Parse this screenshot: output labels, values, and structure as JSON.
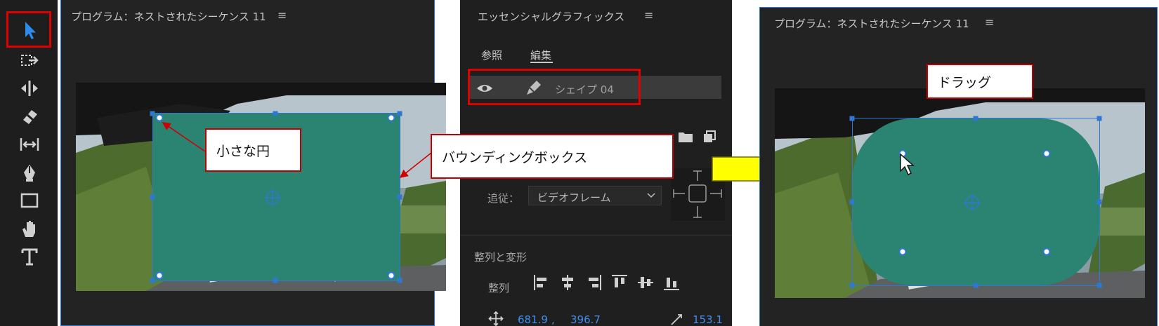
{
  "left_panel": {
    "title": "プログラム：ネストされたシーケンス 11",
    "menu_glyph": "≡"
  },
  "essential_graphics": {
    "title": "エッセンシャルグラフィックス",
    "menu_glyph": "≡",
    "tabs": [
      {
        "label": "参照",
        "active": false
      },
      {
        "label": "編集",
        "active": true
      }
    ],
    "layer": {
      "name": "シェイプ 04"
    },
    "follow": {
      "label": "追従：",
      "value": "ビデオフレーム"
    },
    "align_section": {
      "title": "整列と変形",
      "align_label": "整列"
    },
    "position": {
      "x": "681.9",
      "sep": ",",
      "y": "396.7",
      "scale": "153.1"
    }
  },
  "right_panel": {
    "title": "プログラム：ネストされたシーケンス 11",
    "menu_glyph": "≡"
  },
  "annotations": {
    "small_circle": "小さな円",
    "bounding_box": "バウンディングボックス",
    "drag": "ドラッグ"
  },
  "colors": {
    "shape_fill": "#2b8471",
    "selection_blue": "#2f78d2",
    "annotation_red": "#c00000",
    "arrow_yellow": "#ffff00",
    "drag_arrow": "#f5b800"
  },
  "tools": [
    {
      "name": "selection-tool-icon",
      "selected": true
    },
    {
      "name": "track-select-tool-icon",
      "selected": false
    },
    {
      "name": "ripple-edit-tool-icon",
      "selected": false
    },
    {
      "name": "razor-tool-icon",
      "selected": false
    },
    {
      "name": "slip-tool-icon",
      "selected": false
    },
    {
      "name": "pen-tool-icon",
      "selected": false
    },
    {
      "name": "rectangle-tool-icon",
      "selected": false
    },
    {
      "name": "hand-tool-icon",
      "selected": false
    },
    {
      "name": "type-tool-icon",
      "selected": false
    }
  ]
}
